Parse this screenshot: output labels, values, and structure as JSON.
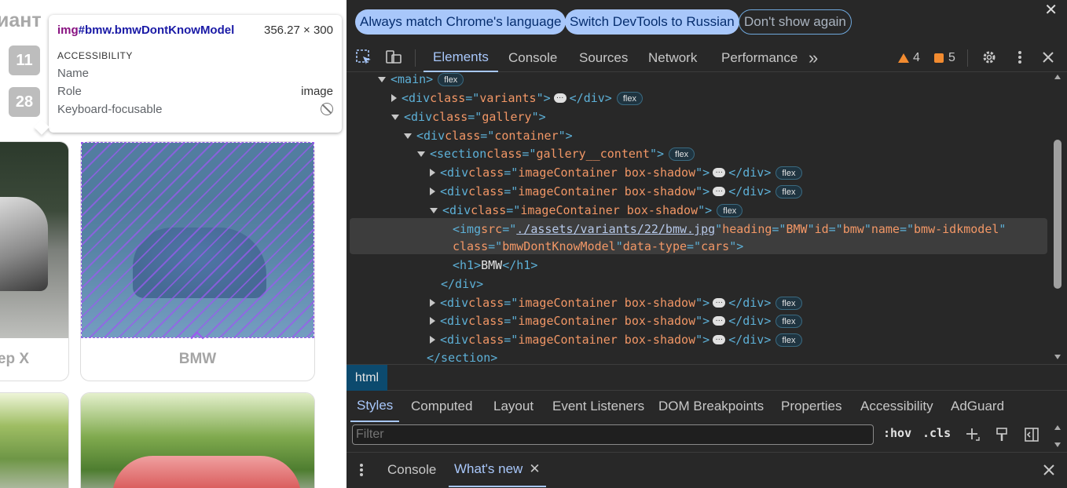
{
  "page": {
    "heading_fragment": "иант",
    "badges": [
      "11",
      "28"
    ],
    "cards": [
      {
        "label": "ер X"
      },
      {
        "label": "BMW"
      }
    ]
  },
  "tooltip": {
    "tag": "img",
    "selector": "#bmw.bmwDontKnowModel",
    "size": "356.27 × 300",
    "section": "ACCESSIBILITY",
    "rows": [
      {
        "key": "Name",
        "value": ""
      },
      {
        "key": "Role",
        "value": "image"
      },
      {
        "key": "Keyboard-focusable",
        "value": ""
      }
    ]
  },
  "devtools": {
    "banner": {
      "match_lang": "Always match Chrome's language",
      "switch_lang": "Switch DevTools to Russian",
      "dont_show": "Don't show again",
      "close": "✕"
    },
    "tabs": [
      "Elements",
      "Console",
      "Sources",
      "Network",
      "Performance"
    ],
    "more": "»",
    "warnings": "4",
    "errors": "5",
    "tree": {
      "main_tag": "main",
      "variants_class": "variants",
      "gallery_class": "gallery",
      "container_class": "container",
      "section_class": "gallery__content",
      "image_container_class": "imageContainer box-shadow",
      "img_src": "./assets/variants/22/bmw.jpg",
      "img_heading": "BMW",
      "img_id": "bmw",
      "img_name": "bmw-idkmodel",
      "img_class": "bmwDontKnowModel",
      "img_datatype": "cars",
      "h1_text": "BMW",
      "flex": "flex"
    },
    "breadcrumb": "html",
    "subtabs": [
      "Styles",
      "Computed",
      "Layout",
      "Event Listeners",
      "DOM Breakpoints",
      "Properties",
      "Accessibility",
      "AdGuard"
    ],
    "filter_placeholder": "Filter",
    "hov": ":hov",
    "cls": ".cls",
    "drawer": {
      "console": "Console",
      "whats_new": "What's new"
    }
  }
}
